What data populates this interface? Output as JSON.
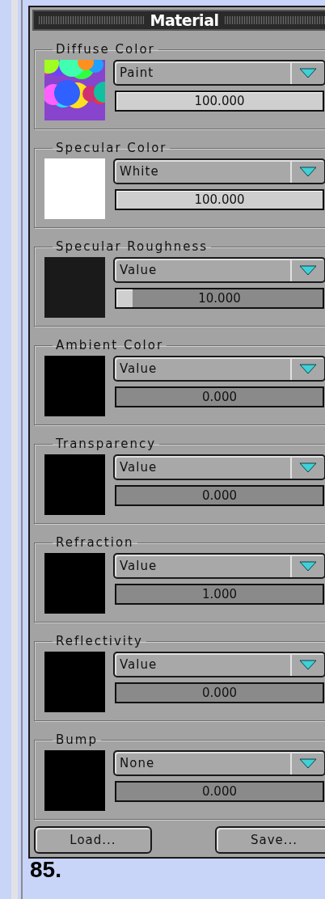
{
  "panel": {
    "title": "Material"
  },
  "groups": [
    {
      "label": "Diffuse Color",
      "swatch": {
        "kind": "texture"
      },
      "mode": "Paint",
      "value": "100.000",
      "level": 1
    },
    {
      "label": "Specular Color",
      "swatch": {
        "kind": "color",
        "color": "#ffffff"
      },
      "mode": "White",
      "value": "100.000",
      "level": 1
    },
    {
      "label": "Specular Roughness",
      "swatch": {
        "kind": "color",
        "color": "#1a1a1a"
      },
      "mode": "Value",
      "value": "10.000",
      "level": 0.08
    },
    {
      "label": "Ambient Color",
      "swatch": {
        "kind": "color",
        "color": "#000000"
      },
      "mode": "Value",
      "value": "0.000"
    },
    {
      "label": "Transparency",
      "swatch": {
        "kind": "color",
        "color": "#000000"
      },
      "mode": "Value",
      "value": "0.000"
    },
    {
      "label": "Refraction",
      "swatch": {
        "kind": "color",
        "color": "#000000"
      },
      "mode": "Value",
      "value": "1.000"
    },
    {
      "label": "Reflectivity",
      "swatch": {
        "kind": "color",
        "color": "#000000"
      },
      "mode": "Value",
      "value": "0.000"
    },
    {
      "label": "Bump",
      "swatch": {
        "kind": "color",
        "color": "#000000"
      },
      "mode": "None",
      "value": "0.000"
    }
  ],
  "buttons": [
    "Load...",
    "Save..."
  ],
  "caption": "85."
}
